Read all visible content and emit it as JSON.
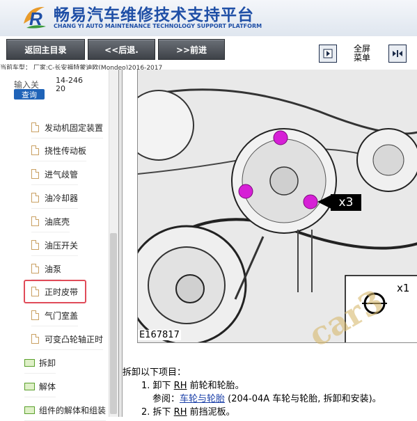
{
  "header": {
    "title_cn": "畅易汽车维修技术支持平台",
    "title_en": "CHANG YI AUTO MAINTENANCE TECHNOLOGY SUPPORT PLATFORM",
    "logo_letter": "R"
  },
  "toolbar": {
    "home_label": "返回主目录",
    "back_label": "<<后退.",
    "forward_label": ">>前进",
    "fullscreen_line1": "全屏",
    "fullscreen_line2": "菜单"
  },
  "model_line": "当前车型： 厂家:C-长安福特蒙迪欧(Mondeo)2016-2017",
  "sidebar": {
    "search_label": "输入关",
    "search_button": "查询",
    "search_value": "14-24620",
    "items": [
      {
        "label": "发动机固定装置",
        "icon": "document-icon"
      },
      {
        "label": "挠性传动板",
        "icon": "document-icon"
      },
      {
        "label": "进气歧管",
        "icon": "document-icon"
      },
      {
        "label": "油冷却器",
        "icon": "document-icon"
      },
      {
        "label": "油底壳",
        "icon": "document-icon"
      },
      {
        "label": "油压开关",
        "icon": "document-icon"
      },
      {
        "label": "油泵",
        "icon": "document-icon"
      },
      {
        "label": "正时皮带",
        "icon": "document-icon",
        "highlight_color": "#e04b59"
      },
      {
        "label": "气门室盖",
        "icon": "document-icon"
      },
      {
        "label": "可变凸轮轴正时",
        "icon": "document-icon"
      },
      {
        "label": "拆卸",
        "icon": "folder-icon"
      },
      {
        "label": "解体",
        "icon": "folder-icon"
      },
      {
        "label": "组件的解体和组装",
        "icon": "folder-icon"
      }
    ]
  },
  "figure": {
    "id_label": "E167817",
    "callout_x3": "x3",
    "callout_x1": "x1",
    "watermark": "car3"
  },
  "content": {
    "intro": "拆卸以下项目：",
    "step1_prefix": "1. 卸下 ",
    "step1_rh": "RH",
    "step1_suffix": " 前轮和轮胎。",
    "ref_prefix": "参阅：",
    "ref_link": "车轮与轮胎",
    "ref_suffix": " (204-04A 车轮与轮胎, 拆卸和安装)。",
    "step2_prefix": "2. 拆下 ",
    "step2_rh": "RH",
    "step2_suffix": " 前挡泥板。"
  },
  "colors": {
    "brand_blue": "#1f4fa6",
    "highlight_red": "#e04b59",
    "bolt_magenta": "#d61fd6"
  }
}
